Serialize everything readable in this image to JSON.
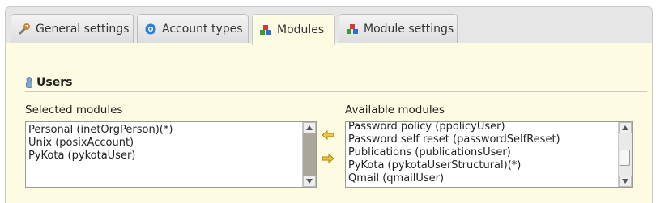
{
  "tabs": [
    {
      "label": "General settings",
      "icon": "wrench-icon"
    },
    {
      "label": "Account types",
      "icon": "gear-globe-icon"
    },
    {
      "label": "Modules",
      "icon": "modules-blocks-icon",
      "active": true
    },
    {
      "label": "Module settings",
      "icon": "modules-blocks-icon"
    }
  ],
  "section": {
    "title": "Users",
    "icon": "user-icon"
  },
  "selected": {
    "label": "Selected modules",
    "items": [
      "Personal (inetOrgPerson)(*)",
      "Unix (posixAccount)",
      "PyKota (pykotaUser)"
    ]
  },
  "available": {
    "label": "Available modules",
    "items": [
      "Password policy (ppolicyUser)",
      "Password self reset (passwordSelfReset)",
      "Publications (publicationsUser)",
      "PyKota (pykotaUserStructural)(*)",
      "Qmail (qmailUser)"
    ]
  },
  "colors": {
    "panel_bg": "#fdfbe2",
    "tab_bg": "#e6e6e6",
    "arrow": "#f0b400"
  }
}
